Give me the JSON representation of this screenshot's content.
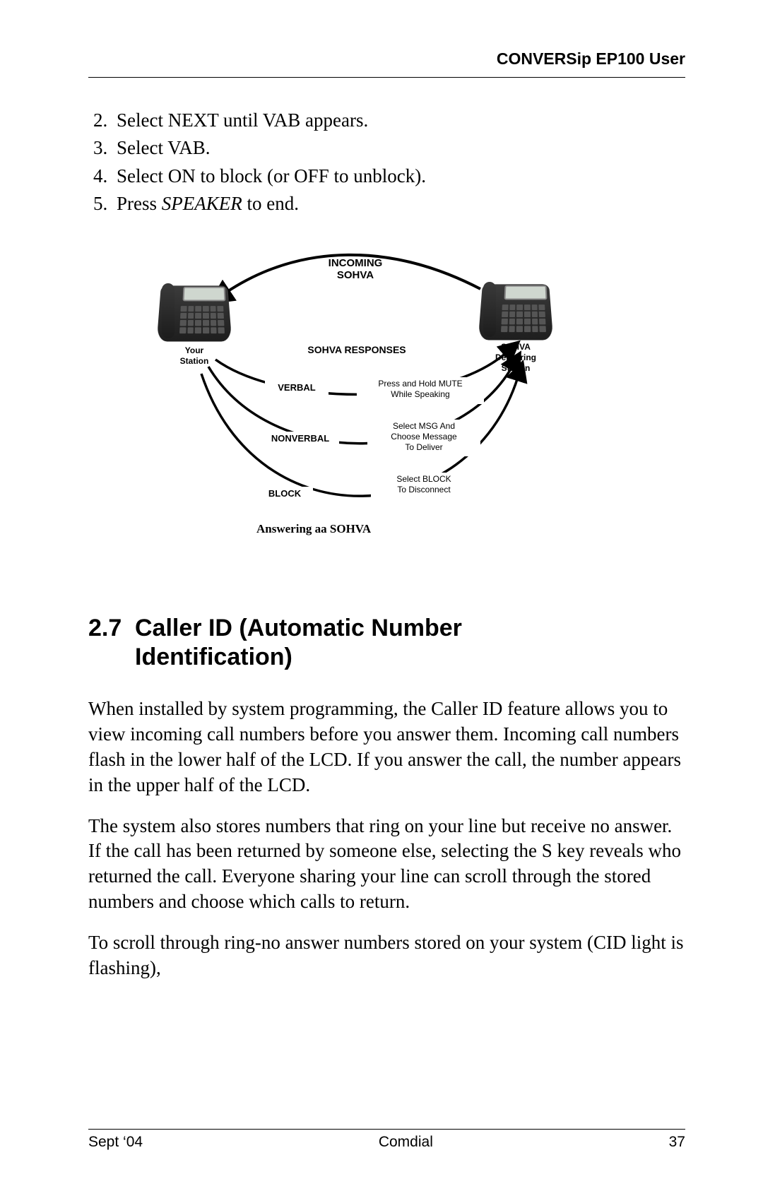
{
  "header": {
    "title": "CONVERSip EP100 User"
  },
  "steps": {
    "start": 2,
    "items": [
      "Select NEXT until VAB appears.",
      "Select VAB.",
      "Select ON to block (or OFF to unblock).",
      "Press SPEAKER to end."
    ],
    "speaker_word": "SPEAKER"
  },
  "diagram": {
    "incoming_line1": "INCOMING",
    "incoming_line2": "SOHVA",
    "responses_title": "SOHVA RESPONSES",
    "left_station_line1": "Your",
    "left_station_line2": "Station",
    "right_station_line1": "SOHVA",
    "right_station_line2": "Delivering",
    "right_station_line3": "Station",
    "verbal": "VERBAL",
    "verbal_desc_line1": "Press and Hold MUTE",
    "verbal_desc_line2": "While Speaking",
    "nonverbal": "NONVERBAL",
    "nonverbal_desc_line1": "Select MSG And",
    "nonverbal_desc_line2": "Choose Message",
    "nonverbal_desc_line3": "To Deliver",
    "block": "BLOCK",
    "block_desc_line1": "Select BLOCK",
    "block_desc_line2": "To Disconnect",
    "caption": "Answering aa SOHVA"
  },
  "section": {
    "number": "2.7",
    "title_line1": "Caller ID (Automatic Number",
    "title_line2": "Identification)"
  },
  "paragraphs": {
    "p1": "When installed by system programming, the Caller ID feature allows you to view incoming call numbers before you answer them. Incoming call numbers flash in the lower half of the LCD. If you answer the call, the number appears in the upper half of the LCD.",
    "p2": "The system also stores numbers that ring on your line but receive no answer. If the call has been returned by someone else, selecting the  S key reveals who returned the call. Everyone sharing your line can scroll through the stored numbers and choose which calls to return.",
    "p3": "To scroll through ring-no answer numbers stored on your system (CID light is flashing),"
  },
  "footer": {
    "left": "Sept ‘04",
    "center": "Comdial",
    "right": "37"
  }
}
